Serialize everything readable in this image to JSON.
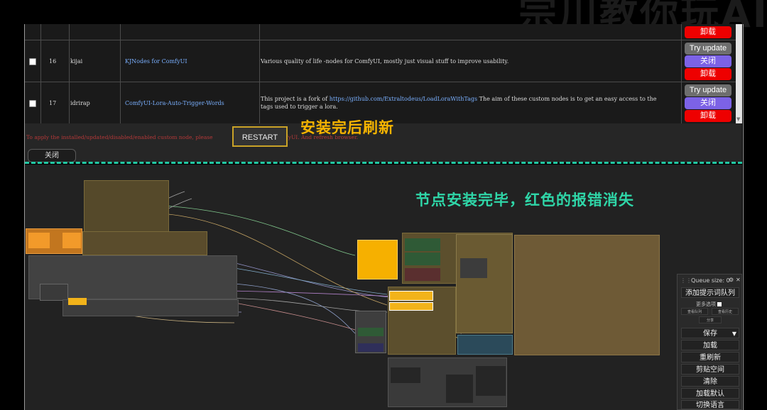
{
  "watermark": "宗川教你玩AI",
  "manager": {
    "top_row": {
      "buttons": [
        "卸载"
      ]
    },
    "rows": [
      {
        "index": "16",
        "author": "kijai",
        "name": "KJNodes for ComfyUI",
        "description": "Various quality of life -nodes for ComfyUI, mostly just visual stuff to improve usability.",
        "buttons": [
          "Try update",
          "关闭",
          "卸载"
        ]
      },
      {
        "index": "17",
        "author": "idrirap",
        "name": "ComfyUI-Lora-Auto-Trigger-Words",
        "description_pre": "This project is a fork of ",
        "description_link": "https://github.com/Extraltodeus/LoadLoraWithTags",
        "description_post": " The aim of these custom nodes is to get an easy access to the",
        "description_line2": "tags used to trigger a lora.",
        "buttons": [
          "Try update",
          "关闭",
          "卸载"
        ]
      }
    ],
    "restart_button": "RESTART",
    "note_pre": "To apply the installed/updated/disabled/enabled custom node, please",
    "note_post": "ComfyUI. And refresh browser.",
    "close_button": "关闭"
  },
  "annotations": {
    "top": "安装完后刷新",
    "canvas": "节点安装完毕，红色的报错消失"
  },
  "queue_panel": {
    "queue_size": "Queue size: 0",
    "queue_prompt": "添加提示词队列",
    "extra_options": "更多选项",
    "view_queue": "查看队列",
    "view_history": "查看历史",
    "share": "分享",
    "save": "保存",
    "load": "加载",
    "refresh": "重刷新",
    "clipspace": "剪贴空间",
    "clear": "清除",
    "load_default": "加载默认",
    "switch_language": "切换语言"
  },
  "colors": {
    "accent_red": "#ee0000",
    "accent_purple": "#7c62e6",
    "annotation_yellow": "#f6b400",
    "annotation_green": "#2fd6a8",
    "divider": "#22c9a4",
    "link_blue": "#7ab0ff"
  }
}
